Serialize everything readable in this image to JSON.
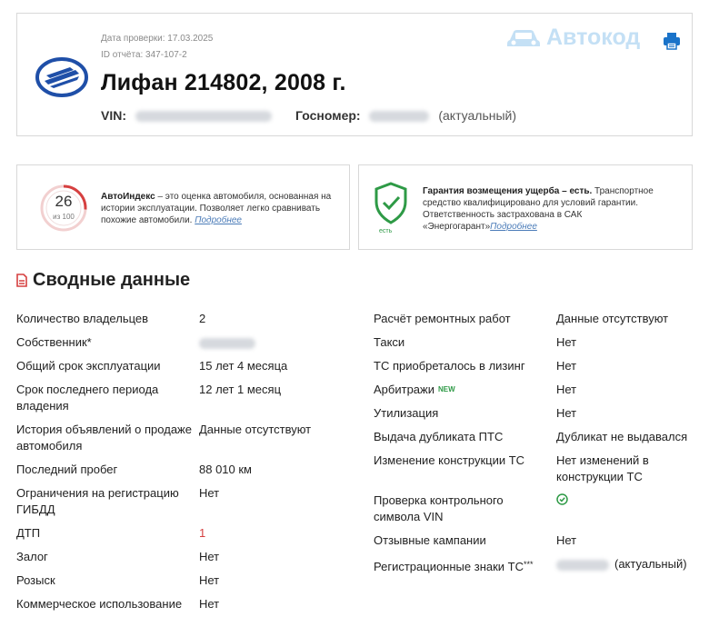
{
  "header": {
    "check_date": "Дата проверки: 17.03.2025",
    "report_id": "ID отчёта: 347-107-2",
    "title": "Лифан 214802, 2008 г.",
    "vin_label": "VIN:",
    "plate_label": "Госномер:",
    "plate_status": "(актуальный)",
    "brand": "Автокод"
  },
  "index_card": {
    "score": "26",
    "score_sub": "из 100",
    "score_value": 26,
    "score_max": 100,
    "title": "АвтоИндекс",
    "text": " – это оценка автомобиля, основанная на истории эксплуатации. Позволяет легко сравнивать похожие автомобили. ",
    "link": "Подробнее"
  },
  "guarantee_card": {
    "icon_caption": "есть",
    "title": "Гарантия возмещения ущерба – есть.",
    "text": " Транспортное средство квалифицировано для условий гарантии. Ответственность застрахована в САК «Энергогарант»",
    "link": "Подробнее"
  },
  "section": {
    "title": "Сводные данные"
  },
  "left_rows": [
    {
      "label": "Количество владельцев",
      "value": "2"
    },
    {
      "label": "Собственник*",
      "value": ""
    },
    {
      "label": "Общий срок эксплуатации",
      "value": "15 лет 4 месяца"
    },
    {
      "label": "Срок последнего периода владения",
      "value": "12 лет 1 месяц"
    },
    {
      "label": "История объявлений о продаже автомобиля",
      "value": "Данные отсутствуют"
    },
    {
      "label": "Последний пробег",
      "value": "88 010 км"
    },
    {
      "label": "Ограничения на регистрацию ГИБДД",
      "value": "Нет"
    },
    {
      "label": "ДТП",
      "value": "1"
    },
    {
      "label": "Залог",
      "value": "Нет"
    },
    {
      "label": "Розыск",
      "value": "Нет"
    },
    {
      "label": "Коммерческое использование",
      "value": "Нет"
    }
  ],
  "right_rows": [
    {
      "label": "Расчёт ремонтных работ",
      "value": "Данные отсутствуют"
    },
    {
      "label": "Такси",
      "value": "Нет"
    },
    {
      "label": "ТС приобреталось в лизинг",
      "value": "Нет"
    },
    {
      "label": "Арбитражи",
      "badge": "NEW",
      "value": "Нет"
    },
    {
      "label": "Утилизация",
      "value": "Нет"
    },
    {
      "label": "Выдача дубликата ПТС",
      "value": "Дубликат не выдавался"
    },
    {
      "label": "Изменение конструкции ТС",
      "value": "Нет изменений в конструкции ТС"
    },
    {
      "label": "Проверка контрольного символа VIN",
      "value": ""
    },
    {
      "label": "Отзывные кампании",
      "value": "Нет"
    },
    {
      "label": "Регистрационные знаки ТС",
      "label_sup": "***",
      "value": "(актуальный)"
    }
  ],
  "colors": {
    "brand_light": "#c4e0f5",
    "print_icon": "#1a73c9",
    "score_ring": "#d64040",
    "accident_value": "#d64040",
    "guarantee": "#2e9a46",
    "lifan_logo": "#1f4fa8"
  }
}
